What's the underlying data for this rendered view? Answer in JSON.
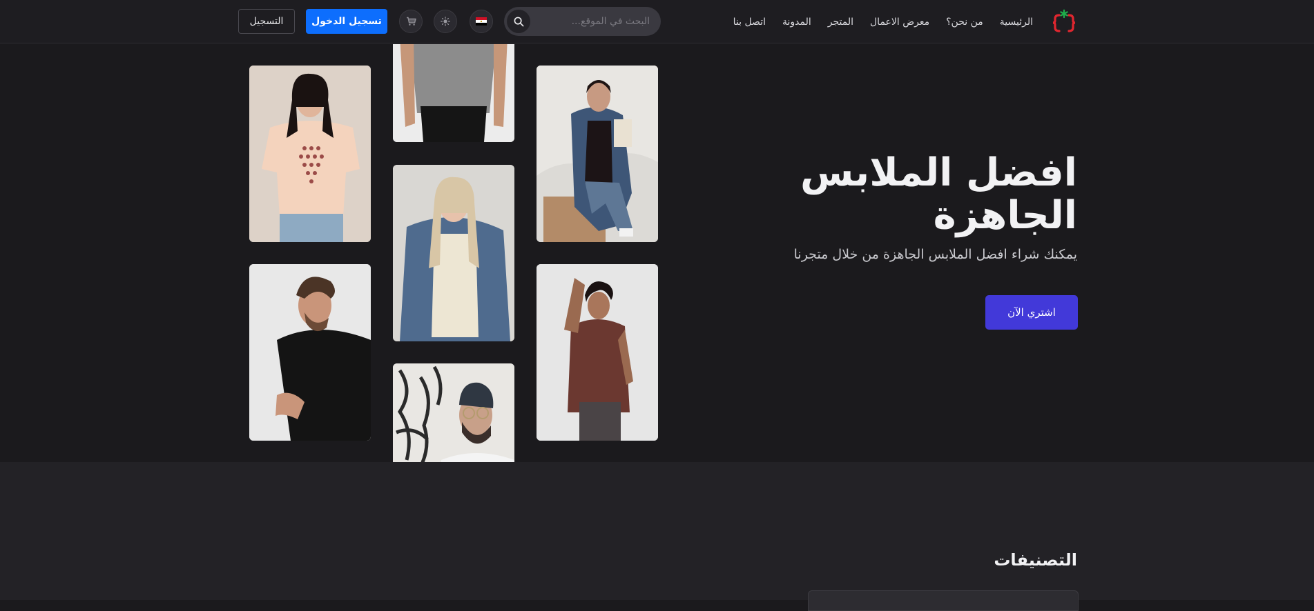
{
  "header": {
    "nav": [
      {
        "label": "الرئيسية"
      },
      {
        "label": "من نحن؟"
      },
      {
        "label": "معرض الاعمال"
      },
      {
        "label": "المتجر"
      },
      {
        "label": "المدونة"
      },
      {
        "label": "اتصل بنا"
      }
    ],
    "search": {
      "placeholder": "البحث في الموقع..."
    },
    "login_label": "تسجيل الدخول",
    "register_label": "التسجيل",
    "icons": {
      "logo": "brand-logo-icon",
      "search": "search-icon",
      "flag": "egypt-flag-icon",
      "theme": "sun-icon",
      "cart": "cart-icon"
    }
  },
  "hero": {
    "title_line1": "افضل الملابس",
    "title_line2": "الجاهزة",
    "subtitle": "يمكنك شراء افضل الملابس الجاهزة من خلال متجرنا",
    "cta_label": "اشتري الآن"
  },
  "categories": {
    "title": "التصنيفات"
  },
  "colors": {
    "accent": "#4239d9",
    "login": "#0d6efd",
    "background": "#1b1a1d"
  }
}
